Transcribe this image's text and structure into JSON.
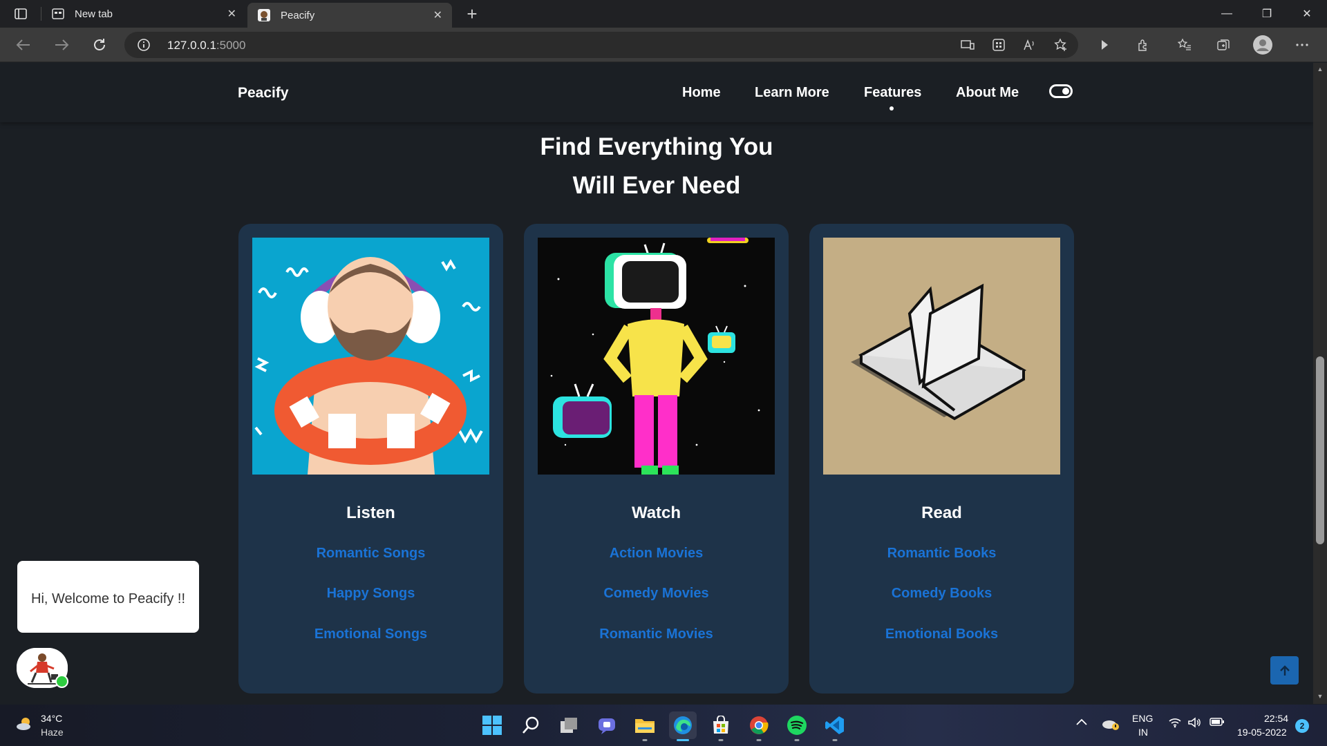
{
  "browser": {
    "tabs": [
      {
        "title": "New tab",
        "close": "✕"
      },
      {
        "title": "Peacify",
        "close": "✕"
      }
    ],
    "new_tab": "+",
    "window_controls": {
      "minimize": "—",
      "restore": "❐",
      "close": "✕"
    },
    "url_host": "127.0.0.1",
    "url_port": ":5000",
    "toolbar_icons": [
      "app-available-icon",
      "apps-icon",
      "read-aloud-icon",
      "add-favorite-icon",
      "forward-arrow-icon",
      "extensions-icon",
      "favorites-icon",
      "collections-icon",
      "profile-icon",
      "more-icon"
    ]
  },
  "site": {
    "brand": "Peacify",
    "nav": {
      "home": "Home",
      "learn_more": "Learn More",
      "features": "Features",
      "about_me": "About Me"
    },
    "active_nav": "Features",
    "heading_line1": "Find Everything You",
    "heading_line2": "Will Ever Need",
    "cards": [
      {
        "title": "Listen",
        "links": [
          "Romantic Songs",
          "Happy Songs",
          "Emotional Songs"
        ]
      },
      {
        "title": "Watch",
        "links": [
          "Action Movies",
          "Comedy Movies",
          "Romantic Movies"
        ]
      },
      {
        "title": "Read",
        "links": [
          "Romantic Books",
          "Comedy Books",
          "Emotional Books"
        ]
      }
    ],
    "chat_message": "Hi, Welcome to Peacify !!"
  },
  "colors": {
    "page_bg": "#1b1f24",
    "card_bg": "#1e3349",
    "link": "#1a73d6",
    "accent_blue": "#1b66b0",
    "online": "#2ecc40"
  },
  "taskbar": {
    "weather_temp": "34°C",
    "weather_desc": "Haze",
    "apps": [
      "start-icon",
      "search-icon",
      "task-view-icon",
      "teams-chat-icon",
      "file-explorer-icon",
      "edge-icon",
      "store-icon",
      "chrome-icon",
      "spotify-icon",
      "vscode-icon"
    ],
    "lang_1": "ENG",
    "lang_2": "IN",
    "time": "22:54",
    "date": "19-05-2022",
    "notifications": "2"
  }
}
